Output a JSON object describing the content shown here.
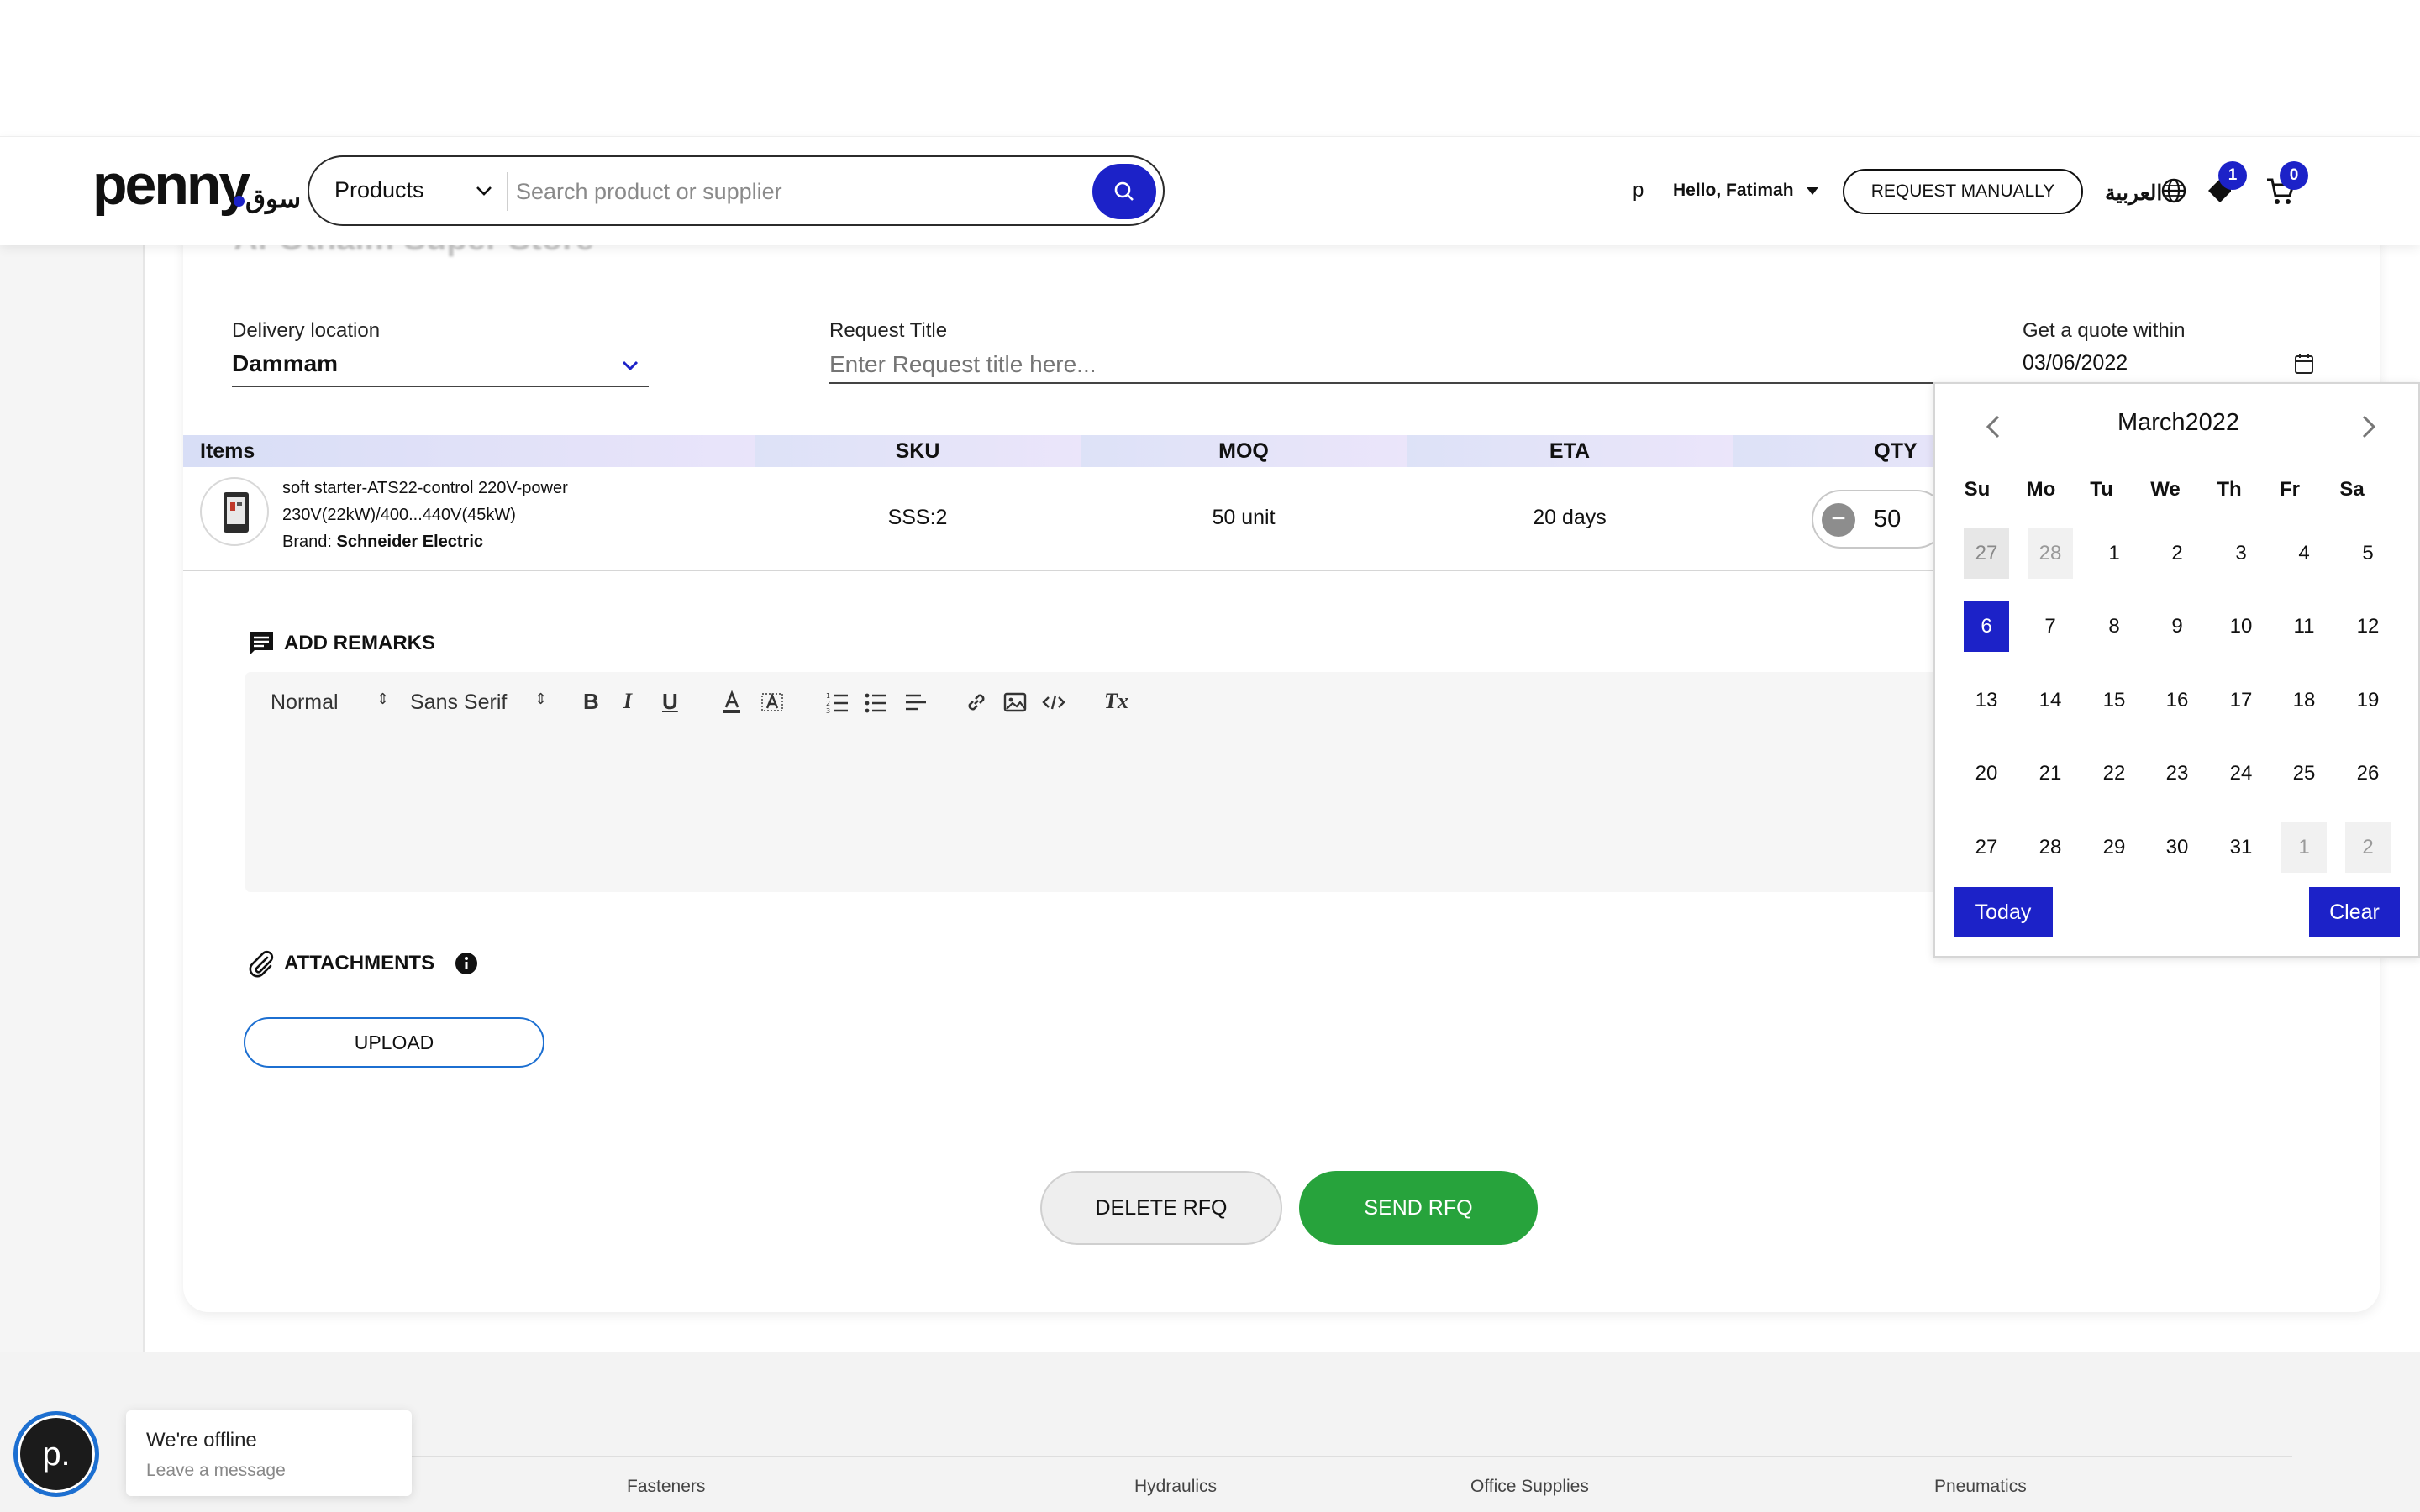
{
  "header": {
    "logo_text": "penny",
    "logo_arabic": "سوق",
    "search_category": "Products",
    "search_placeholder": "Search product or supplier",
    "user_initial": "p",
    "greeting": "Hello, Fatimah",
    "request_manually_label": "REQUEST MANUALLY",
    "language_label": "العربية",
    "wishlist_count": "1",
    "cart_count": "0"
  },
  "card": {
    "store_title": "Al-Othaim Super Store"
  },
  "form": {
    "delivery_label": "Delivery location",
    "delivery_value": "Dammam",
    "request_title_label": "Request Title",
    "request_title_placeholder": "Enter Request title here...",
    "quote_label": "Get a quote within",
    "quote_value": "03/06/2022"
  },
  "table": {
    "headers": [
      "Items",
      "SKU",
      "MOQ",
      "ETA",
      "QTY"
    ],
    "rows": [
      {
        "name_line1": "soft starter-ATS22-control 220V-power",
        "name_line2": "230V(22kW)/400...440V(45kW)",
        "brand_prefix": "Brand:",
        "brand": "Schneider Electric",
        "sku": "SSS:2",
        "moq": "50 unit",
        "eta": "20 days",
        "qty": "50"
      }
    ]
  },
  "remarks": {
    "title": "ADD REMARKS",
    "toolbar": {
      "size": "Normal",
      "font": "Sans Serif",
      "bold": "B",
      "italic": "I",
      "underline": "U",
      "clear_format": "Tx"
    }
  },
  "attachments": {
    "title": "ATTACHMENTS",
    "upload_label": "UPLOAD"
  },
  "actions": {
    "delete_label": "DELETE RFQ",
    "send_label": "SEND RFQ"
  },
  "calendar": {
    "month_label": "March2022",
    "weekdays": [
      "Su",
      "Mo",
      "Tu",
      "We",
      "Th",
      "Fr",
      "Sa"
    ],
    "weeks": [
      [
        "27",
        "28",
        "1",
        "2",
        "3",
        "4",
        "5"
      ],
      [
        "6",
        "7",
        "8",
        "9",
        "10",
        "11",
        "12"
      ],
      [
        "13",
        "14",
        "15",
        "16",
        "17",
        "18",
        "19"
      ],
      [
        "20",
        "21",
        "22",
        "23",
        "24",
        "25",
        "26"
      ],
      [
        "27",
        "28",
        "29",
        "30",
        "31",
        "1",
        "2"
      ]
    ],
    "selected_day": "6",
    "today_label": "Today",
    "clear_label": "Clear"
  },
  "chat": {
    "avatar_letter": "p.",
    "status": "We're offline",
    "subtext": "Leave a message"
  },
  "footer": {
    "links": [
      "Fasteners",
      "Hydraulics",
      "Office Supplies",
      "Pneumatics"
    ]
  },
  "colors": {
    "brand_blue": "#1c22c8",
    "send_green": "#27a33c",
    "table_header_gradient": [
      "#d6ddf6",
      "#ece6fb"
    ]
  }
}
